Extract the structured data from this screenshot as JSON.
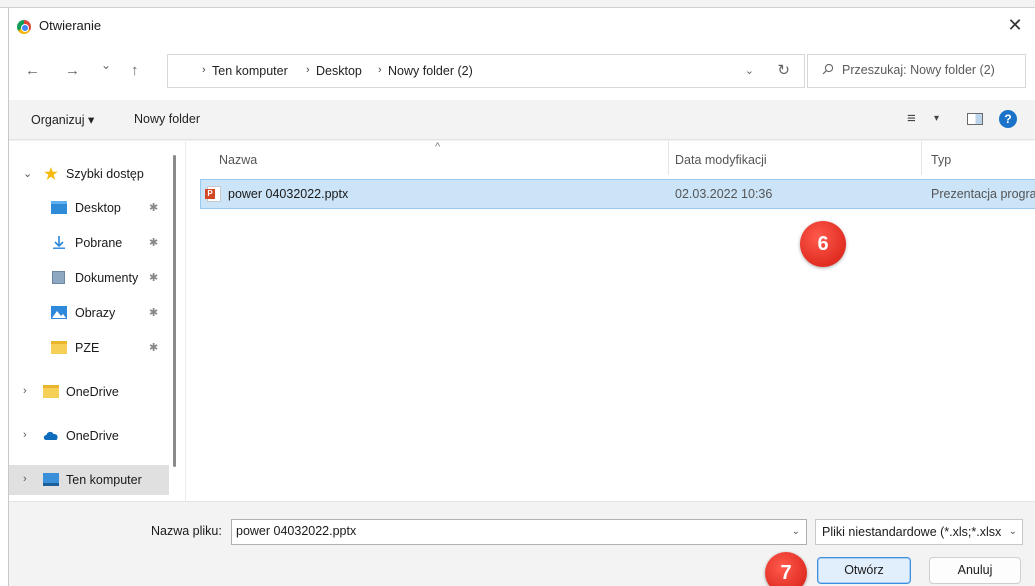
{
  "window": {
    "title": "Otwieranie",
    "close_glyph": "✕"
  },
  "nav": {
    "back_glyph": "←",
    "forward_glyph": "→",
    "recent_glyph": "⌄",
    "up_glyph": "↑",
    "breadcrumb": [
      "Ten komputer",
      "Desktop",
      "Nowy folder (2)"
    ],
    "separator_glyph": "›",
    "dropdown_glyph": "⌄",
    "refresh_glyph": "↻",
    "search_placeholder": "Przeszukaj: Nowy folder (2)"
  },
  "toolbar": {
    "organize_label": "Organizuj ▾",
    "new_folder_label": "Nowy folder",
    "view_glyph": "≡",
    "view_dropdown_glyph": "▾",
    "help_glyph": "?"
  },
  "sidebar": {
    "items": [
      {
        "label": "Szybki dostęp",
        "icon": "star-icon",
        "chevron": "⌄",
        "pinned": false
      },
      {
        "label": "Desktop",
        "icon": "desktop-icon",
        "chevron": "",
        "pinned": true
      },
      {
        "label": "Pobrane",
        "icon": "download-icon",
        "chevron": "",
        "pinned": true
      },
      {
        "label": "Dokumenty",
        "icon": "documents-icon",
        "chevron": "",
        "pinned": true
      },
      {
        "label": "Obrazy",
        "icon": "pictures-icon",
        "chevron": "",
        "pinned": true
      },
      {
        "label": "PZE",
        "icon": "folder-icon",
        "chevron": "",
        "pinned": true
      },
      {
        "label": "OneDrive",
        "icon": "folder-icon",
        "chevron": "›",
        "pinned": false
      },
      {
        "label": "OneDrive",
        "icon": "cloud-icon",
        "chevron": "›",
        "pinned": false
      },
      {
        "label": "Ten komputer",
        "icon": "computer-icon",
        "chevron": "›",
        "pinned": false
      }
    ],
    "pin_glyph": "✱",
    "selected": "Ten komputer"
  },
  "files": {
    "columns": [
      "Nazwa",
      "Data modyfikacji",
      "Typ"
    ],
    "sort_glyph": "^",
    "rows": [
      {
        "name": "power 04032022.pptx",
        "modified": "02.03.2022 10:36",
        "type": "Prezentacja programu"
      }
    ]
  },
  "annotations": {
    "step_6": "6",
    "step_7": "7"
  },
  "footer": {
    "filename_label": "Nazwa pliku:",
    "filename_value": "power 04032022.pptx",
    "dropdown_glyph": "⌄",
    "filter_value": "Pliki niestandardowe (*.xls;*.xlsx",
    "open_label": "Otwórz",
    "cancel_label": "Anuluj"
  },
  "colors": {
    "selection": "#cce4f7",
    "accent": "#1a73c8",
    "badge": "#d41a10"
  }
}
